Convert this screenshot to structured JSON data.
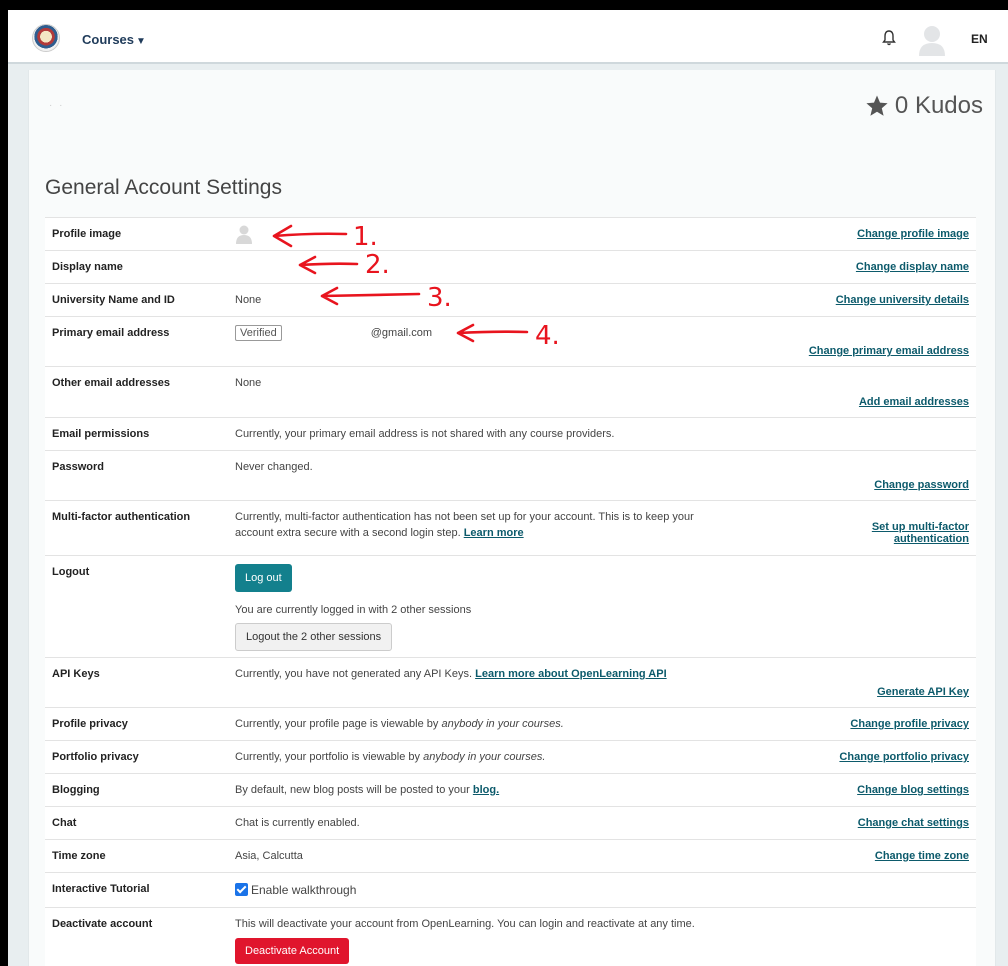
{
  "nav": {
    "courses_label": "Courses",
    "lang": "EN",
    "icons": {
      "logo": "university-crest-logo",
      "bell": "bell-icon",
      "avatar": "avatar-icon",
      "caret": "caret-down-icon"
    }
  },
  "header": {
    "kudos_count": "0",
    "kudos_label": "Kudos"
  },
  "page_title": "General Account Settings",
  "rows": [
    {
      "label": "Profile image",
      "action": "Change profile image"
    },
    {
      "label": "Display name",
      "value": "",
      "action": "Change display name"
    },
    {
      "label": "University Name and ID",
      "value": "None",
      "action": "Change university details"
    },
    {
      "label": "Primary email address",
      "badge": "Verified",
      "value": "@gmail.com",
      "action": "Change primary email address"
    },
    {
      "label": "Other email addresses",
      "value": "None",
      "action": "Add email addresses"
    },
    {
      "label": "Email permissions",
      "value": "Currently, your primary email address is not shared with any course providers."
    },
    {
      "label": "Password",
      "value": "Never changed.",
      "action": "Change password"
    },
    {
      "label": "Multi-factor authentication",
      "value": "Currently, multi-factor authentication has not been set up for your account. This is to keep your account extra secure with a second login step.",
      "link": "Learn more",
      "action": "Set up multi-factor authentication"
    },
    {
      "label": "Logout",
      "button": "Log out",
      "value": "You are currently logged in with 2 other sessions",
      "button2": "Logout the 2 other sessions"
    },
    {
      "label": "API Keys",
      "value": "Currently, you have not generated any API Keys.",
      "link": "Learn more about OpenLearning API",
      "action": "Generate API Key"
    },
    {
      "label": "Profile privacy",
      "value": "Currently, your profile page is viewable by",
      "emph": "anybody in your courses.",
      "action": "Change profile privacy"
    },
    {
      "label": "Portfolio privacy",
      "value": "Currently, your portfolio is viewable by",
      "emph": "anybody in your courses.",
      "action": "Change portfolio privacy"
    },
    {
      "label": "Blogging",
      "value": "By default, new blog posts will be posted to your",
      "link": "blog.",
      "action": "Change blog settings"
    },
    {
      "label": "Chat",
      "value": "Chat is currently enabled.",
      "action": "Change chat settings"
    },
    {
      "label": "Time zone",
      "value": "Asia, Calcutta",
      "action": "Change time zone"
    },
    {
      "label": "Interactive Tutorial",
      "checkbox_label": "Enable walkthrough",
      "checked": true
    },
    {
      "label": "Deactivate account",
      "value": "This will deactivate your account from OpenLearning. You can login and reactivate at any time.",
      "button": "Deactivate Account"
    }
  ],
  "annotations": [
    "1.",
    "2.",
    "3.",
    "4."
  ],
  "colors": {
    "accent_link": "#0c5a6b",
    "teal_button": "#13808d",
    "danger": "#e0152d",
    "annotation": "#e8141e"
  }
}
